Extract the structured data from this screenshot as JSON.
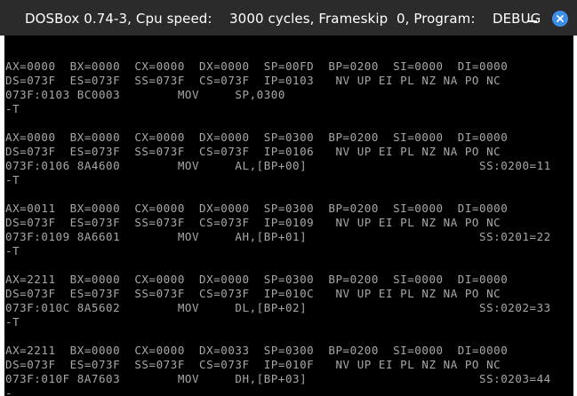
{
  "window": {
    "title": "DOSBox 0.74-3, Cpu speed:    3000 cycles, Frameskip  0, Program:    DEBUG"
  },
  "icons": {
    "minimize": "minimize-icon",
    "close": "close-icon"
  },
  "colors": {
    "titlebar": "#2b2b2b",
    "close_button": "#3d8fe6",
    "console_background": "#000000",
    "console_text": "#a8a8a8"
  },
  "console": {
    "lines": [
      "",
      "AX=0000  BX=0000  CX=0000  DX=0000  SP=00FD  BP=0200  SI=0000  DI=0000",
      "DS=073F  ES=073F  SS=073F  CS=073F  IP=0103   NV UP EI PL NZ NA PO NC",
      "073F:0103 BC0003        MOV     SP,0300",
      "-T",
      "",
      "AX=0000  BX=0000  CX=0000  DX=0000  SP=0300  BP=0200  SI=0000  DI=0000",
      "DS=073F  ES=073F  SS=073F  CS=073F  IP=0106   NV UP EI PL NZ NA PO NC",
      "073F:0106 8A4600        MOV     AL,[BP+00]                        SS:0200=11",
      "-T",
      "",
      "AX=0011  BX=0000  CX=0000  DX=0000  SP=0300  BP=0200  SI=0000  DI=0000",
      "DS=073F  ES=073F  SS=073F  CS=073F  IP=0109   NV UP EI PL NZ NA PO NC",
      "073F:0109 8A6601        MOV     AH,[BP+01]                        SS:0201=22",
      "-T",
      "",
      "AX=2211  BX=0000  CX=0000  DX=0000  SP=0300  BP=0200  SI=0000  DI=0000",
      "DS=073F  ES=073F  SS=073F  CS=073F  IP=010C   NV UP EI PL NZ NA PO NC",
      "073F:010C 8A5602        MOV     DL,[BP+02]                        SS:0202=33",
      "-T",
      "",
      "AX=2211  BX=0000  CX=0000  DX=0033  SP=0300  BP=0200  SI=0000  DI=0000",
      "DS=073F  ES=073F  SS=073F  CS=073F  IP=010F   NV UP EI PL NZ NA PO NC",
      "073F:010F 8A7603        MOV     DH,[BP+03]                        SS:0203=44"
    ],
    "prompt": "-"
  }
}
